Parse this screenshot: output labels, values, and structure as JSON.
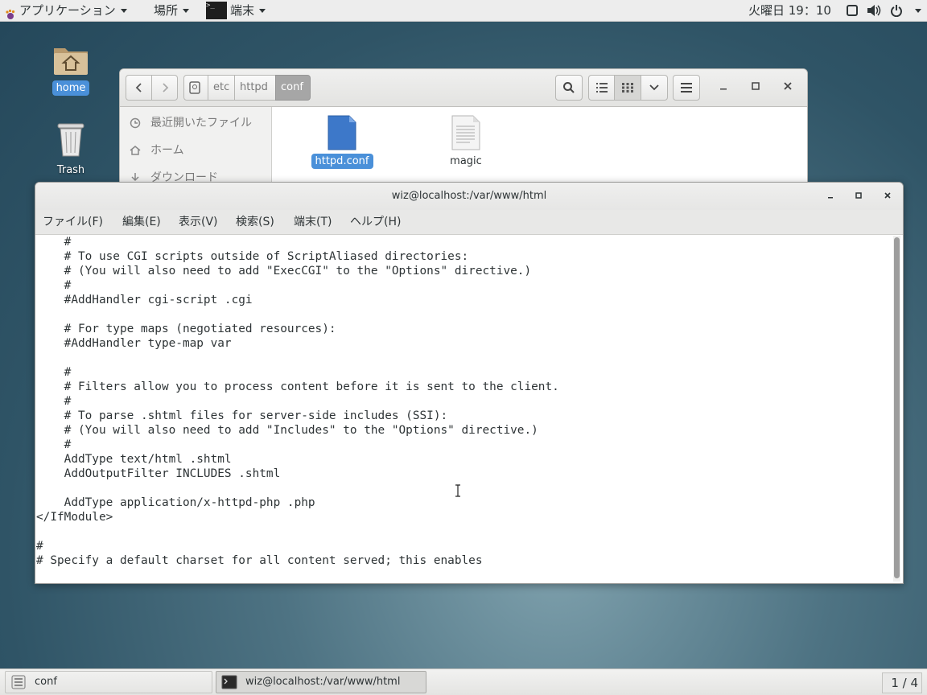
{
  "topbar": {
    "apps_label": "アプリケーション",
    "places_label": "場所",
    "terminal_label": "端末",
    "clock": "火曜日 19：10"
  },
  "desktop": {
    "home_label": "home",
    "trash_label": "Trash"
  },
  "file_manager": {
    "breadcrumbs": [
      "etc",
      "httpd",
      "conf"
    ],
    "sidebar": [
      "最近開いたファイル",
      "ホーム",
      "ダウンロード"
    ],
    "files": [
      "httpd.conf",
      "magic"
    ]
  },
  "terminal": {
    "title": "wiz@localhost:/var/www/html",
    "menu": [
      "ファイル(F)",
      "編集(E)",
      "表示(V)",
      "検索(S)",
      "端末(T)",
      "ヘルプ(H)"
    ],
    "lines": [
      "    #",
      "    # To use CGI scripts outside of ScriptAliased directories:",
      "    # (You will also need to add \"ExecCGI\" to the \"Options\" directive.)",
      "    #",
      "    #AddHandler cgi-script .cgi",
      "",
      "    # For type maps (negotiated resources):",
      "    #AddHandler type-map var",
      "",
      "    #",
      "    # Filters allow you to process content before it is sent to the client.",
      "    #",
      "    # To parse .shtml files for server-side includes (SSI):",
      "    # (You will also need to add \"Includes\" to the \"Options\" directive.)",
      "    #",
      "    AddType text/html .shtml",
      "    AddOutputFilter INCLUDES .shtml",
      "",
      "    AddType application/x-httpd-php .php",
      "</IfModule>",
      "",
      "#",
      "# Specify a default charset for all content served; this enables"
    ]
  },
  "taskbar": {
    "tasks": [
      "conf",
      "wiz@localhost:/var/www/html"
    ],
    "workspace": "1 / 4"
  }
}
